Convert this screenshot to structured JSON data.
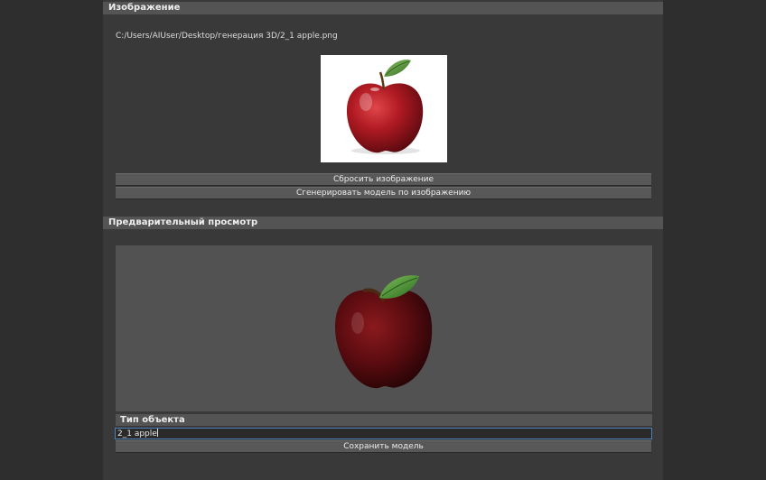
{
  "image_section": {
    "header": "Изображение",
    "file_path": "C:/Users/AIUser/Desktop/генерация 3D/2_1 apple.png",
    "reset_button": "Сбросить изображение",
    "generate_button": "Сгенерировать модель по изображению"
  },
  "preview_section": {
    "header": "Предварительный просмотр",
    "object_type_label": "Тип объекта",
    "object_name_value": "2_1 apple",
    "save_button": "Сохранить модель"
  },
  "colors": {
    "background": "#2e2e2e",
    "panel": "#393939",
    "header": "#545454",
    "button": "#585858",
    "viewport": "#525252",
    "input_focus_border": "#4d7fb8"
  },
  "icons": [
    "apple-thumbnail",
    "apple-3d-model"
  ]
}
